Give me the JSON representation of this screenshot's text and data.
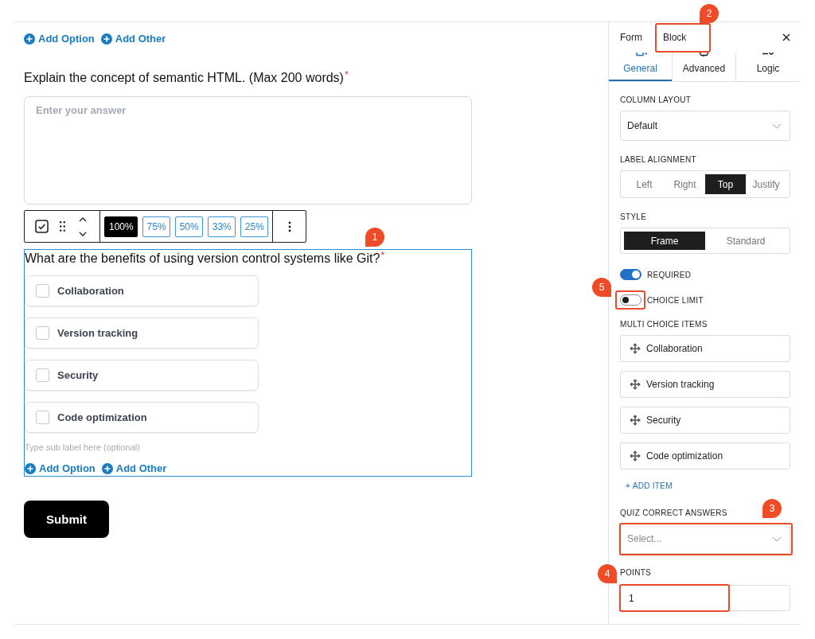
{
  "form": {
    "previous_block_links": [
      {
        "label": "Add Option"
      },
      {
        "label": "Add Other"
      }
    ],
    "questions": [
      {
        "kind": "text",
        "label": "Explain the concept of semantic HTML. (Max 200 words)",
        "required_mark": "*",
        "selected": false,
        "placeholder": "Enter your answer"
      },
      {
        "kind": "multi_choice",
        "label": "What are the benefits of using version control systems like Git?",
        "required_mark": "*",
        "selected": true,
        "callout": "1",
        "toolbar": {
          "widths": [
            {
              "label": "100%",
              "selected": true
            },
            {
              "label": "75%",
              "selected": false
            },
            {
              "label": "50%",
              "selected": false
            },
            {
              "label": "33%",
              "selected": false
            },
            {
              "label": "25%",
              "selected": false
            }
          ]
        },
        "options": [
          {
            "label": "Collaboration",
            "checked": false
          },
          {
            "label": "Version tracking",
            "checked": false
          },
          {
            "label": "Security",
            "checked": false
          },
          {
            "label": "Code optimization",
            "checked": false
          }
        ],
        "sub_label_placeholder": "Type sub label here (optional)",
        "links": [
          {
            "label": "Add Option"
          },
          {
            "label": "Add Other"
          }
        ]
      }
    ],
    "submit": "Submit"
  },
  "sidebar": {
    "header_tabs": [
      {
        "label": "Form"
      },
      {
        "label": "Block",
        "callout": "2"
      }
    ],
    "tabs": [
      {
        "label": "General",
        "selected": true
      },
      {
        "label": "Advanced",
        "selected": false
      },
      {
        "label": "Logic",
        "selected": false
      }
    ],
    "sections": [
      {
        "kind": "select",
        "label": "COLUMN LAYOUT",
        "value": "Default"
      },
      {
        "kind": "segmented",
        "label": "LABEL ALIGNMENT",
        "options": [
          {
            "label": "Left",
            "selected": false
          },
          {
            "label": "Right",
            "selected": false
          },
          {
            "label": "Top",
            "selected": true
          },
          {
            "label": "Justify",
            "selected": false
          }
        ]
      },
      {
        "kind": "segmented",
        "label": "STYLE",
        "options": [
          {
            "label": "Frame",
            "selected": true
          },
          {
            "label": "Standard",
            "selected": false
          }
        ]
      },
      {
        "kind": "toggle",
        "label": "REQUIRED",
        "on": true
      },
      {
        "kind": "toggle",
        "label": "CHOICE LIMIT",
        "on": false,
        "callout": "5"
      },
      {
        "kind": "list",
        "label": "MULTI CHOICE ITEMS",
        "items": [
          {
            "label": "Collaboration"
          },
          {
            "label": "Version tracking"
          },
          {
            "label": "Security"
          },
          {
            "label": "Code optimization"
          }
        ],
        "add_label": "+ ADD ITEM"
      },
      {
        "kind": "select",
        "label": "QUIZ CORRECT ANSWERS",
        "placeholder": "Select...",
        "callout": "3"
      },
      {
        "kind": "input",
        "label": "POINTS",
        "value": "1",
        "callout": "4"
      }
    ]
  }
}
